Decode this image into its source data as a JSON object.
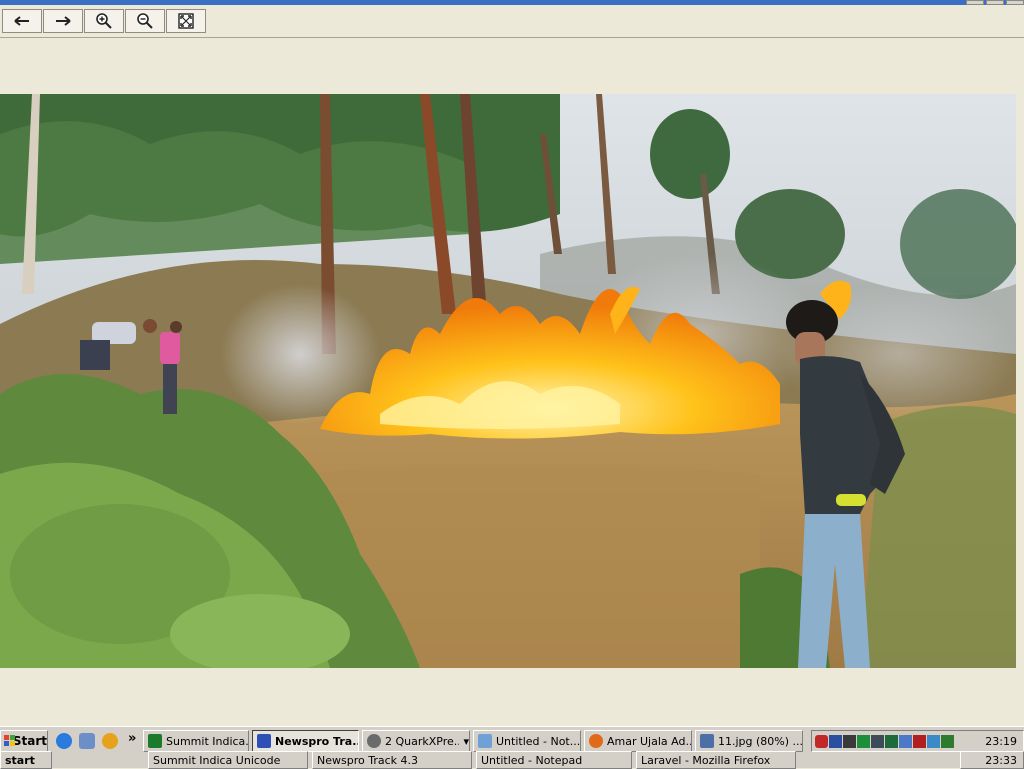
{
  "window": {
    "title_visible": ""
  },
  "toolbar": {
    "buttons": [
      {
        "name": "previous-image",
        "icon": "arrow-left-icon"
      },
      {
        "name": "next-image",
        "icon": "arrow-right-icon"
      },
      {
        "name": "zoom-in",
        "icon": "zoom-in-icon"
      },
      {
        "name": "zoom-out",
        "icon": "zoom-out-icon"
      },
      {
        "name": "fit-to-window",
        "icon": "fit-window-icon"
      }
    ]
  },
  "photo": {
    "alt": "Forest fire on a hillside with a man standing in the foreground"
  },
  "taskbar": {
    "start_label": "start",
    "start_label_cap": "Start",
    "overflow": "»",
    "tasks": [
      {
        "label": "Summit Indica...",
        "color": "#1c7a2d"
      },
      {
        "label": "Newspro Tra...",
        "color": "#2e4fb5",
        "active": true
      },
      {
        "label": "2 QuarkXPre...",
        "color": "#6b6b6b",
        "dropdown": "▾"
      },
      {
        "label": "Untitled - Not...",
        "color": "#6fa0d6"
      },
      {
        "label": "Amar Ujala Ad...",
        "color": "#e06a1a"
      },
      {
        "label": "11.jpg (80%) ...",
        "color": "#4d6fa8"
      }
    ],
    "row2_tasks": [
      {
        "label": "Summit Indica Unicode"
      },
      {
        "label": "Newspro Track 4.3"
      },
      {
        "label": "Untitled - Notepad"
      },
      {
        "label": "Laravel - Mozilla Firefox"
      }
    ],
    "clock": "23:19",
    "clock2": "23:33"
  },
  "colors": {
    "taskbar": "#d4d0c8",
    "title": "#3a6fc4"
  }
}
